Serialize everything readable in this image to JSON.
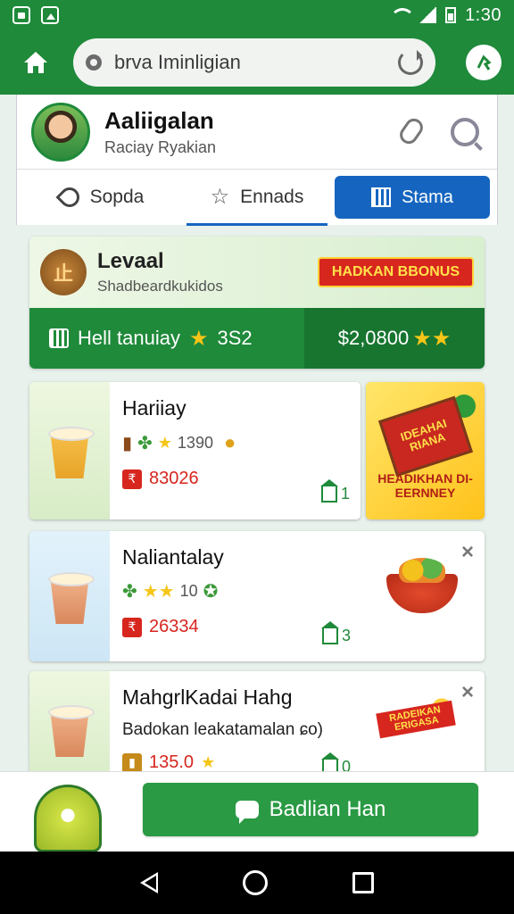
{
  "status_bar": {
    "time": "1:30"
  },
  "toolbar": {
    "url_text": "brva Ιminligian"
  },
  "profile": {
    "name": "Aaliigalan",
    "subtitle": "Raciay Ryakian"
  },
  "tabs": [
    {
      "label": "Sopda",
      "icon": "key-icon"
    },
    {
      "label": "Ennads",
      "icon": "star-outline-icon"
    },
    {
      "label": "Stama",
      "icon": "grid-icon",
      "active": true
    }
  ],
  "level": {
    "icon_text": "止",
    "title": "Levaal",
    "subtitle": "Shadbeardkukidos",
    "bonus": "HADKAN BBONUS",
    "stat_label": "Hell tanuiay",
    "stat_value": "3S2",
    "balance": "$2,0800"
  },
  "items": [
    {
      "title": "Hariiay",
      "meta": "1390",
      "price": "83026",
      "count": "1"
    },
    {
      "title": "Naliantalay",
      "meta": "10",
      "price": "26334",
      "count": "3"
    },
    {
      "title": "MahgrlKadai Hahg",
      "subtitle": "Badokan leakatamalan ɕo)",
      "price": "135.0",
      "count": "0"
    }
  ],
  "promo": {
    "flag_text": "IDEAHAI RIANA",
    "caption": "HEADIKHAN DI- EERNNEY"
  },
  "ribbon_text": "RADEIKAN ERIGASA",
  "cta": {
    "label": "Badlian Han"
  },
  "colors": {
    "primary": "#1f8a3a",
    "accent_blue": "#1565c0",
    "red": "#d7261e",
    "gold": "#f5c518"
  }
}
